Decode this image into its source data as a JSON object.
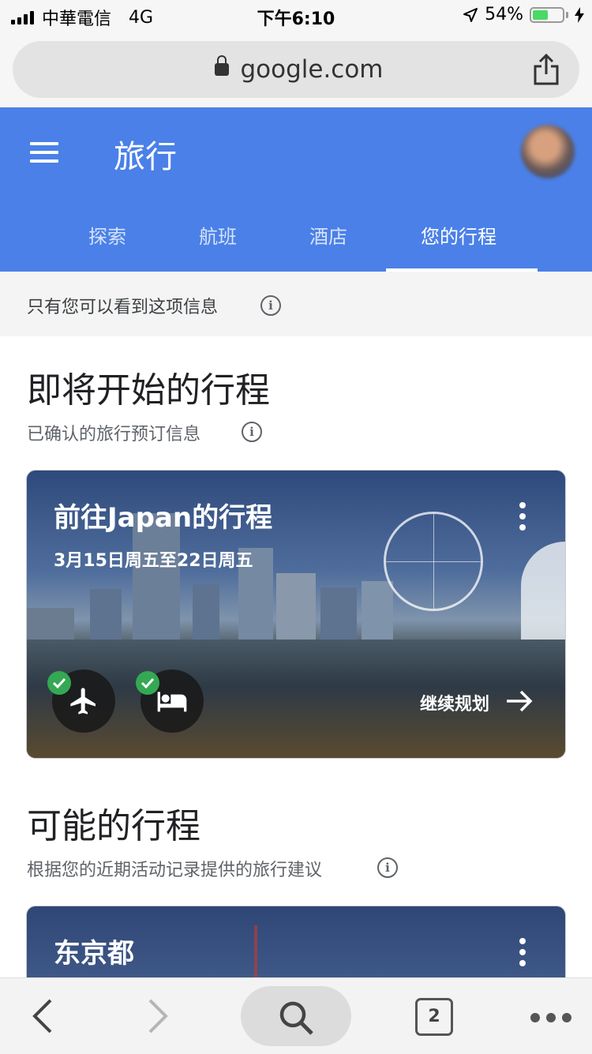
{
  "status_bar": {
    "carrier": "中華電信",
    "network": "4G",
    "time": "下午6:10",
    "battery_percent": "54%",
    "battery_level": 0.54
  },
  "browser": {
    "url": "google.com",
    "tab_count": "2"
  },
  "app": {
    "title": "旅行",
    "tabs": [
      {
        "label": "探索"
      },
      {
        "label": "航班"
      },
      {
        "label": "酒店"
      },
      {
        "label": "您的行程",
        "active": true
      }
    ]
  },
  "notice": {
    "text": "只有您可以看到这项信息"
  },
  "upcoming": {
    "title": "即将开始的行程",
    "subtitle": "已确认的旅行预订信息",
    "card": {
      "title": "前往Japan的行程",
      "dates": "3月15日周五至22日周五",
      "continue_label": "继续规划"
    }
  },
  "possible": {
    "title": "可能的行程",
    "subtitle": "根据您的近期活动记录提供的旅行建议",
    "card": {
      "title": "东京都"
    }
  },
  "colors": {
    "header_blue": "#4a80e8",
    "check_green": "#34a853"
  }
}
